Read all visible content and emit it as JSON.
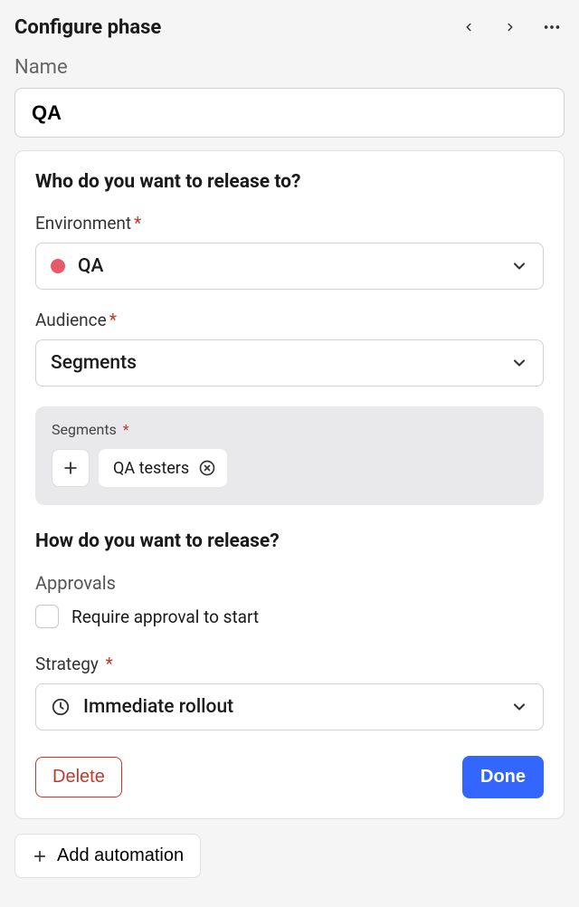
{
  "header": {
    "title": "Configure phase"
  },
  "name": {
    "label": "Name",
    "value": "QA"
  },
  "who": {
    "title": "Who do you want to release to?",
    "environment": {
      "label": "Environment",
      "value": "QA",
      "color": "#e85a6a"
    },
    "audience": {
      "label": "Audience",
      "value": "Segments"
    },
    "segments": {
      "label": "Segments",
      "chips": [
        "QA testers"
      ]
    }
  },
  "how": {
    "title": "How do you want to release?",
    "approvals": {
      "label": "Approvals",
      "checkbox_label": "Require approval to start",
      "checked": false
    },
    "strategy": {
      "label": "Strategy",
      "value": "Immediate rollout"
    }
  },
  "footer": {
    "delete": "Delete",
    "done": "Done"
  },
  "add_automation": "Add automation"
}
